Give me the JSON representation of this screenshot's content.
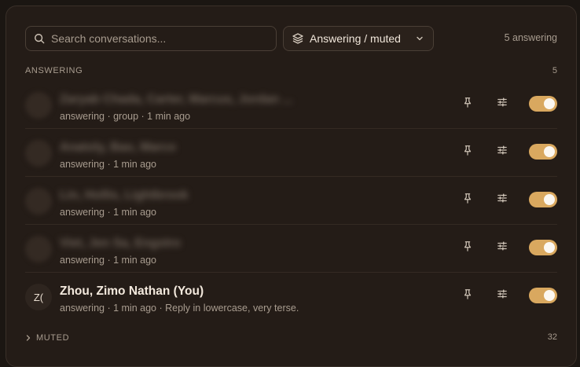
{
  "toolbar": {
    "search_placeholder": "Search conversations...",
    "filter_label": "Answering / muted",
    "answering_count": "5 answering"
  },
  "answering_section": {
    "label": "ANSWERING",
    "count": "5"
  },
  "rows": [
    {
      "avatar": "",
      "title": "Zaryab Chada, Carter, Marcus, Jordan ...",
      "subtitle": "answering · group · 1 min ago",
      "blurred": true
    },
    {
      "avatar": "",
      "title": "Anatoly, Bao, Marco",
      "subtitle": "answering · 1 min ago",
      "blurred": true
    },
    {
      "avatar": "",
      "title": "Lin, Hollis, Lightbrook",
      "subtitle": "answering · 1 min ago",
      "blurred": true
    },
    {
      "avatar": "",
      "title": "Viet, Jen Sa, Engstro",
      "subtitle": "answering · 1 min ago",
      "blurred": true
    },
    {
      "avatar": "Z(",
      "title": "Zhou, Zimo Nathan (You)",
      "subtitle": "answering · 1 min ago · Reply in lowercase, very terse.",
      "blurred": false
    }
  ],
  "muted_section": {
    "label": "MUTED",
    "count": "32"
  },
  "colors": {
    "accent": "#d9a85f",
    "panel": "#241c17",
    "background": "#1b1612"
  },
  "icons": {
    "search": "search-icon",
    "filter": "layers-icon",
    "pin": "pin-icon",
    "settings": "sliders-icon",
    "expand": "chevron-right-icon"
  }
}
